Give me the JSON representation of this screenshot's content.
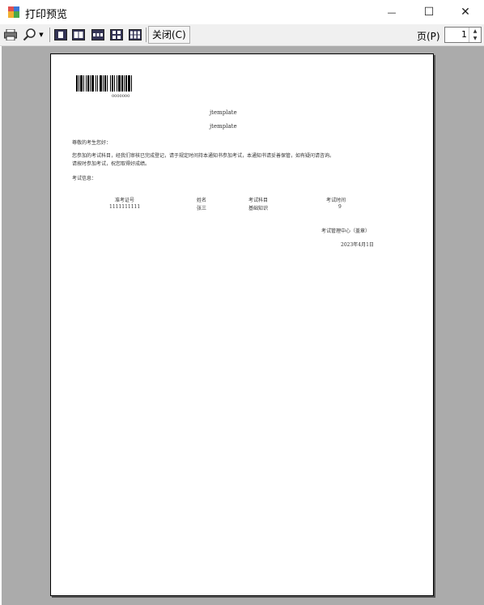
{
  "window": {
    "title": "打印预览",
    "minimize": "—",
    "maximize": "☐",
    "close": "✕"
  },
  "toolbar": {
    "icons": [
      "print-icon",
      "zoom-icon",
      "one-page-icon",
      "two-pages-icon",
      "three-pages-icon",
      "four-pages-icon",
      "six-pages-icon"
    ],
    "close_label": "关闭(C)",
    "page_label": "页(P)",
    "page_value": "1"
  },
  "document": {
    "barcode_text": "0000000",
    "title1": "jtemplate",
    "title2": "jtemplate",
    "greeting": "尊敬的考生您好：",
    "body_line1": "您参加的考试科目，经我们审核已完成登记，请于规定时间持本通知书参加考试，本通知书请妥善保管，如有疑问请咨询。",
    "body_line2": "请按时参加考试，祝您取得好成绩。",
    "list_intro": "考试信息：",
    "table_headers": [
      "准考证号",
      "姓名",
      "考试科目",
      "考试时间"
    ],
    "table_row": [
      "1111111111",
      "张三",
      "基础知识",
      "9"
    ],
    "signature": "考试管理中心（盖章）",
    "date": "2023年4月1日"
  }
}
